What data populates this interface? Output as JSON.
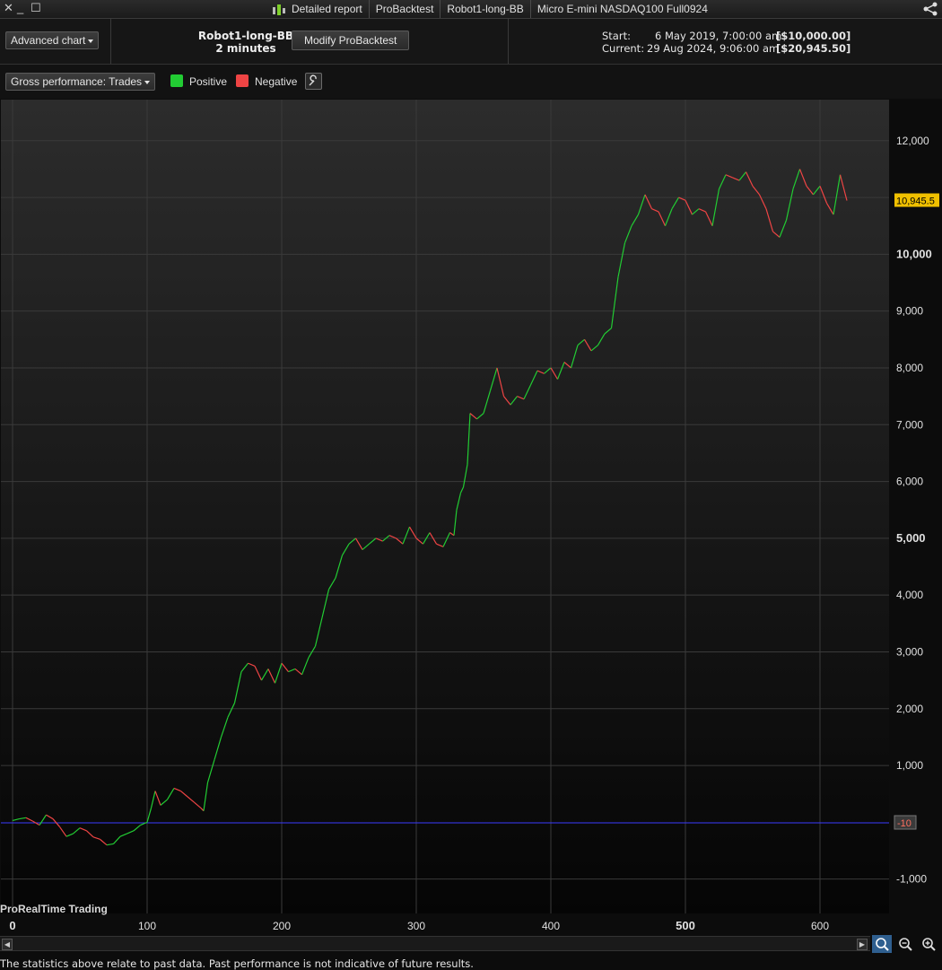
{
  "window": {
    "breadcrumbs": [
      "Detailed report",
      "ProBacktest",
      "Robot1-long-BB",
      "Micro E-mini NASDAQ100 Full0924"
    ]
  },
  "header": {
    "advanced_chart_label": "Advanced chart",
    "robot_name": "Robot1-long-BB",
    "timeframe": "2 minutes",
    "modify_button": "Modify ProBacktest",
    "start_label": "Start:",
    "start_date": "6 May 2019, 7:00:00 am",
    "start_capital": "[$10,000.00]",
    "current_label": "Current:",
    "current_date": "29 Aug 2024, 9:06:00 am",
    "current_capital": "[$20,945.50]"
  },
  "toolbar": {
    "metric_select": "Gross performance: Trades",
    "legend_positive": "Positive",
    "legend_negative": "Negative",
    "positive_color": "#22cc33",
    "negative_color": "#ee4444"
  },
  "chart_data": {
    "type": "line",
    "xlabel": "",
    "ylabel": "",
    "xlim": [
      0,
      650
    ],
    "ylim": [
      -1500,
      12800
    ],
    "x_ticks": [
      0,
      100,
      200,
      300,
      400,
      500,
      600
    ],
    "y_ticks": [
      -1000,
      1000,
      2000,
      3000,
      4000,
      5000,
      6000,
      7000,
      8000,
      9000,
      10000,
      11000,
      12000
    ],
    "y_tick_labels": [
      "-1,000",
      "1,000",
      "2,000",
      "3,000",
      "4,000",
      "5,000",
      "6,000",
      "7,000",
      "8,000",
      "9,000",
      "10,000",
      "11,000",
      "12,000"
    ],
    "x_tick_labels": [
      "0",
      "100",
      "200",
      "300",
      "400",
      "500",
      "600"
    ],
    "last_value": 10945.5,
    "last_value_label": "10,945.5",
    "baseline_value": -10,
    "baseline_label": "-10",
    "grid": true,
    "series": [
      {
        "x": [
          0,
          5,
          10,
          15,
          20,
          25,
          30,
          35,
          40,
          45,
          50,
          55,
          60,
          65,
          70,
          75,
          80,
          85,
          90,
          95,
          100,
          103,
          106,
          110,
          115,
          120,
          125,
          130,
          135,
          140,
          142,
          145,
          150,
          155,
          160,
          165,
          170,
          175,
          180,
          185,
          190,
          195,
          200,
          205,
          210,
          215,
          220,
          225,
          230,
          235,
          240,
          245,
          250,
          255,
          260,
          265,
          270,
          275,
          280,
          285,
          290,
          295,
          300,
          305,
          310,
          315,
          320,
          325,
          328,
          330,
          333,
          335,
          338,
          340,
          345,
          350,
          355,
          360,
          365,
          370,
          375,
          380,
          385,
          390,
          395,
          400,
          405,
          410,
          415,
          420,
          425,
          430,
          435,
          440,
          445,
          450,
          455,
          460,
          465,
          470,
          475,
          480,
          485,
          490,
          495,
          500,
          505,
          510,
          515,
          520,
          525,
          530,
          535,
          540,
          545,
          550,
          555,
          560,
          565,
          570,
          575,
          580,
          585,
          590,
          595,
          600,
          605,
          610,
          615,
          620
        ],
        "y": [
          30,
          60,
          80,
          20,
          -50,
          130,
          60,
          -80,
          -250,
          -200,
          -100,
          -150,
          -260,
          -300,
          -400,
          -380,
          -250,
          -200,
          -150,
          -50,
          0,
          250,
          550,
          300,
          400,
          600,
          550,
          450,
          350,
          250,
          200,
          700,
          1100,
          1500,
          1850,
          2100,
          2650,
          2800,
          2750,
          2500,
          2700,
          2450,
          2800,
          2650,
          2700,
          2600,
          2900,
          3100,
          3600,
          4100,
          4300,
          4700,
          4900,
          5000,
          4800,
          4900,
          5000,
          4950,
          5050,
          5000,
          4900,
          5200,
          5000,
          4900,
          5100,
          4900,
          4850,
          5100,
          5050,
          5500,
          5800,
          5900,
          6300,
          7200,
          7100,
          7200,
          7600,
          8000,
          7500,
          7350,
          7500,
          7450,
          7700,
          7950,
          7900,
          8000,
          7800,
          8100,
          8000,
          8400,
          8500,
          8300,
          8400,
          8600,
          8700,
          9600,
          10200,
          10500,
          10700,
          11050,
          10800,
          10750,
          10500,
          10800,
          11000,
          10950,
          10700,
          10800,
          10750,
          10500,
          11150,
          11400,
          11350,
          11300,
          11450,
          11200,
          11050,
          10800,
          10400,
          10300,
          10600,
          11150,
          11500,
          11200,
          11050,
          11200,
          10900,
          10700,
          11400,
          10945.5
        ]
      }
    ]
  },
  "branding": {
    "brand": "ProRealTime Trading"
  },
  "footer": {
    "disclaimer": "The statistics above relate to past data. Past performance is not indicative of future results."
  }
}
